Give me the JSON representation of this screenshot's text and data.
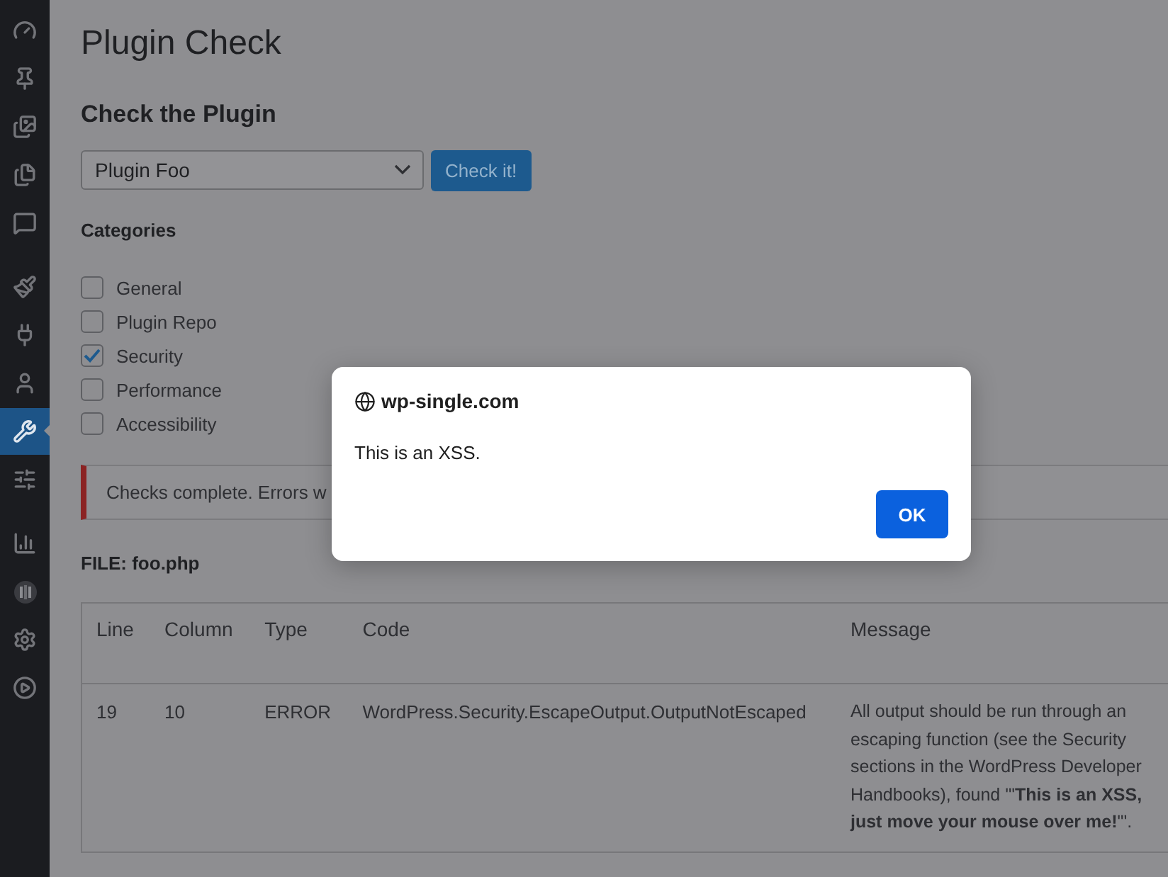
{
  "sidebar": {
    "groups": [
      {
        "items": [
          {
            "kind": "dashboard",
            "selected": false
          },
          {
            "kind": "posts",
            "selected": false
          },
          {
            "kind": "media",
            "selected": false
          },
          {
            "kind": "pages",
            "selected": false
          },
          {
            "kind": "comments",
            "selected": false
          }
        ]
      },
      {
        "items": [
          {
            "kind": "appearance",
            "selected": false
          },
          {
            "kind": "plugins",
            "selected": false
          },
          {
            "kind": "users",
            "selected": false
          },
          {
            "kind": "tools",
            "selected": true
          },
          {
            "kind": "settings-sliders",
            "selected": false
          }
        ]
      },
      {
        "items": [
          {
            "kind": "stats",
            "selected": false
          },
          {
            "kind": "logo",
            "selected": false
          },
          {
            "kind": "gear",
            "selected": false
          },
          {
            "kind": "play",
            "selected": false
          }
        ]
      }
    ]
  },
  "page": {
    "title": "Plugin Check",
    "section_title": "Check the Plugin",
    "plugin_select": {
      "value": "Plugin Foo"
    },
    "check_button": "Check it!",
    "categories_label": "Categories",
    "categories": [
      {
        "label": "General",
        "checked": false
      },
      {
        "label": "Plugin Repo",
        "checked": false
      },
      {
        "label": "Security",
        "checked": true
      },
      {
        "label": "Performance",
        "checked": false
      },
      {
        "label": "Accessibility",
        "checked": false
      }
    ],
    "notice": "Checks complete. Errors w",
    "file_label": "FILE: foo.php",
    "table": {
      "columns": [
        "Line",
        "Column",
        "Type",
        "Code",
        "Message"
      ],
      "rows": [
        {
          "cells": [
            "19",
            "10",
            "ERROR",
            "WordPress.Security.EscapeOutput.OutputNotEscaped",
            "All output should be run through an escaping function (see the Security sections in the WordPress Developer Handbooks), found '\"**This is an XSS, just move your mouse over me!**\"'."
          ]
        }
      ]
    }
  },
  "dialog": {
    "host": "wp-single.com",
    "message": "This is an XSS.",
    "button": "OK"
  }
}
